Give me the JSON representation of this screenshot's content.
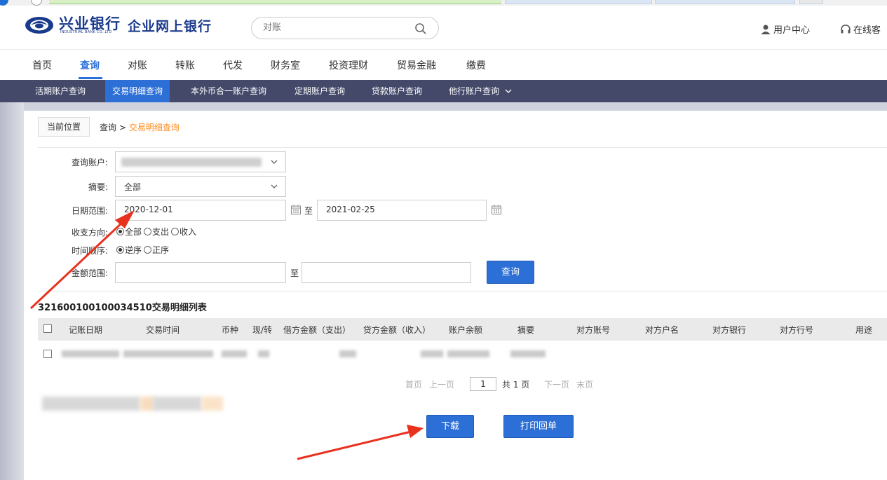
{
  "colors": {
    "brand_blue": "#1a3a8c",
    "accent_blue": "#2c6fd6",
    "subnav_bg": "#44496a",
    "breadcrumb_current": "#ff8c1a",
    "arrow_red": "#e8321e"
  },
  "header": {
    "logo_cn": "兴业银行",
    "logo_en": "INDUSTRIAL BANK CO.,LTD",
    "site_title": "企业网上银行",
    "search_placeholder": "对账",
    "user_center": "用户中心",
    "online_service": "在线客"
  },
  "main_nav": [
    {
      "label": "首页"
    },
    {
      "label": "查询"
    },
    {
      "label": "对账"
    },
    {
      "label": "转账"
    },
    {
      "label": "代发"
    },
    {
      "label": "财务室"
    },
    {
      "label": "投资理财"
    },
    {
      "label": "贸易金融"
    },
    {
      "label": "缴费"
    }
  ],
  "sub_nav": [
    {
      "label": "活期账户查询"
    },
    {
      "label": "交易明细查询"
    },
    {
      "label": "本外币合一账户查询"
    },
    {
      "label": "定期账户查询"
    },
    {
      "label": "贷款账户查询"
    },
    {
      "label": "他行账户查询"
    }
  ],
  "breadcrumb": {
    "location": "当前位置",
    "parent": "查询 >",
    "current": "交易明细查询"
  },
  "form": {
    "account_label": "查询账户:",
    "summary_label": "摘要:",
    "summary_value": "全部",
    "date_label": "日期范围:",
    "date_from": "2020-12-01",
    "date_to": "2021-02-25",
    "to_text": "至",
    "direction_label": "收支方向:",
    "direction_options": [
      "全部",
      "支出",
      "收入"
    ],
    "order_label": "时间顺序:",
    "order_options": [
      "逆序",
      "正序"
    ],
    "amount_label": "金额范围:",
    "query_button": "查询"
  },
  "table": {
    "title": "321600100100034510交易明细列表",
    "columns": [
      "记账日期",
      "交易时间",
      "币种",
      "现/转",
      "借方金额（支出）",
      "贷方金额（收入）",
      "账户余额",
      "摘要",
      "对方账号",
      "对方户名",
      "对方银行",
      "对方行号",
      "用途"
    ]
  },
  "pager": {
    "first": "首页",
    "prev": "上一页",
    "current": "1",
    "total": "共 1 页",
    "next": "下一页",
    "last": "末页"
  },
  "actions": {
    "download": "下载",
    "print": "打印回单"
  }
}
